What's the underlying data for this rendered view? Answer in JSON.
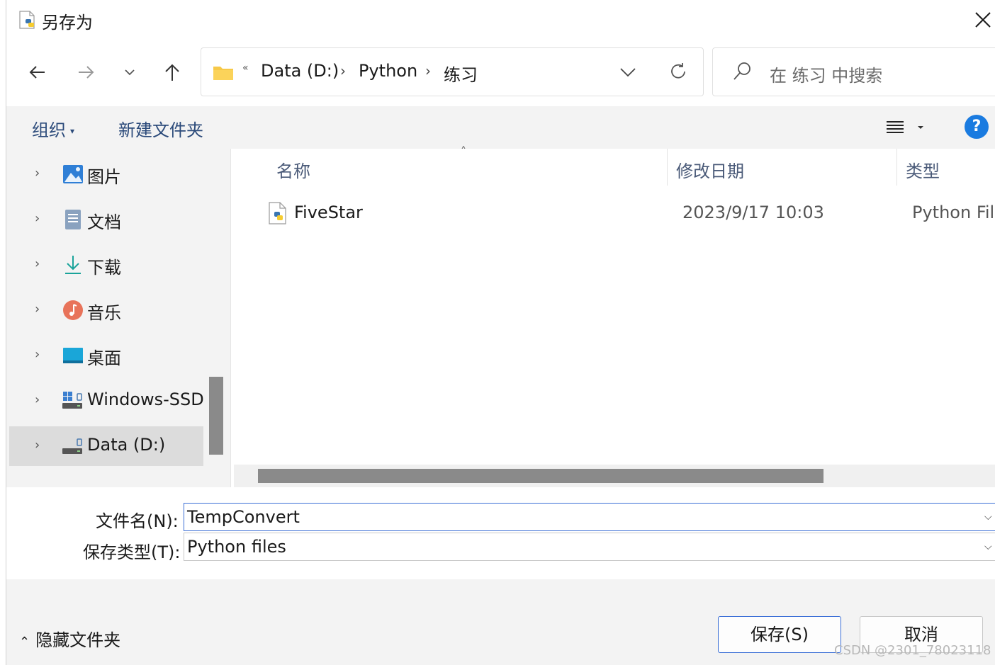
{
  "window": {
    "title": "另存为",
    "close_label": "×"
  },
  "address": {
    "overflow_chevron": "«",
    "crumbs": [
      "Data (D:)",
      "Python",
      "练习"
    ],
    "separator": "›"
  },
  "search": {
    "placeholder": "在 练习 中搜索"
  },
  "toolbar": {
    "organize_label": "组织",
    "new_folder_label": "新建文件夹",
    "help_label": "?"
  },
  "sidebar": {
    "items": [
      {
        "label": "图片",
        "icon": "pictures-icon"
      },
      {
        "label": "文档",
        "icon": "documents-icon"
      },
      {
        "label": "下载",
        "icon": "downloads-icon"
      },
      {
        "label": "音乐",
        "icon": "music-icon"
      },
      {
        "label": "桌面",
        "icon": "desktop-icon"
      },
      {
        "label": "Windows-SSD",
        "icon": "drive-icon"
      },
      {
        "label": "Data (D:)",
        "icon": "drive-icon",
        "selected": true
      }
    ]
  },
  "file_list": {
    "columns": [
      "名称",
      "修改日期",
      "类型"
    ],
    "rows": [
      {
        "name": "FiveStar",
        "modified": "2023/9/17 10:03",
        "type": "Python File",
        "icon": "python-file-icon"
      }
    ]
  },
  "form": {
    "filename_label": "文件名(N):",
    "filename_value": "TempConvert",
    "filetype_label": "保存类型(T):",
    "filetype_value": "Python files"
  },
  "footer": {
    "hide_folders_label": "隐藏文件夹",
    "save_label": "保存(S)",
    "cancel_label": "取消",
    "watermark": "CSDN @2301_78023118"
  },
  "colors": {
    "accent": "#1a7be0",
    "toolbar_bg": "#f3f3f3",
    "selected_bg": "#dcdcdc",
    "focus_border": "#3b6fd6"
  }
}
